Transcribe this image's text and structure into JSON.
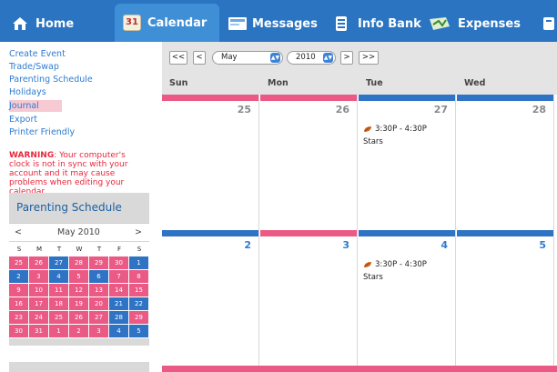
{
  "nav": {
    "tabs": [
      {
        "label": "Home",
        "icon": "home-icon"
      },
      {
        "label": "Calendar",
        "icon": "calendar-icon",
        "icon_text": "31",
        "active": true
      },
      {
        "label": "Messages",
        "icon": "messages-icon"
      },
      {
        "label": "Info Bank",
        "icon": "info-bank-icon"
      },
      {
        "label": "Expenses",
        "icon": "expenses-icon"
      }
    ]
  },
  "sidebar": {
    "links": [
      "Create Event",
      "Trade/Swap",
      "Parenting Schedule",
      "Holidays",
      "Journal",
      "Export",
      "Printer Friendly"
    ],
    "highlighted_link": "Journal",
    "warning_label": "WARNING",
    "warning_text": ": Your computer's clock is not in sync with your account and it may cause problems when editing your calendar.",
    "parenting_title": "Parenting Schedule",
    "mini_calendar": {
      "prev": "<",
      "month": "May 2010",
      "next": ">",
      "dow": [
        "S",
        "M",
        "T",
        "W",
        "T",
        "F",
        "S"
      ],
      "rows": [
        [
          "25",
          "26",
          "27",
          "28",
          "29",
          "30",
          "1"
        ],
        [
          "2",
          "3",
          "4",
          "5",
          "6",
          "7",
          "8"
        ],
        [
          "9",
          "10",
          "11",
          "12",
          "13",
          "14",
          "15"
        ],
        [
          "16",
          "17",
          "18",
          "19",
          "20",
          "21",
          "22"
        ],
        [
          "23",
          "24",
          "25",
          "26",
          "27",
          "28",
          "29"
        ],
        [
          "30",
          "31",
          "1",
          "2",
          "3",
          "4",
          "5"
        ]
      ],
      "colors": [
        [
          "p",
          "p",
          "b",
          "p",
          "p",
          "p",
          "b"
        ],
        [
          "b",
          "p",
          "b",
          "p",
          "b",
          "p",
          "p"
        ],
        [
          "p",
          "p",
          "p",
          "p",
          "p",
          "p",
          "p"
        ],
        [
          "p",
          "p",
          "p",
          "p",
          "p",
          "b",
          "b"
        ],
        [
          "p",
          "p",
          "p",
          "p",
          "p",
          "b",
          "p"
        ],
        [
          "p",
          "p",
          "p",
          "p",
          "p",
          "b",
          "b"
        ]
      ]
    }
  },
  "main": {
    "controls": {
      "first": "<<",
      "prev": "<",
      "month": "May",
      "year": "2010",
      "next": ">",
      "last": ">>"
    },
    "days_of_week": [
      "Sun",
      "Mon",
      "Tue",
      "Wed"
    ],
    "week1": [
      {
        "num": "25",
        "bar": "p",
        "style": "g"
      },
      {
        "num": "26",
        "bar": "p",
        "style": "g"
      },
      {
        "num": "27",
        "bar": "b",
        "style": "g",
        "event_time": "3:30P - 4:30P",
        "event_name": "Stars"
      },
      {
        "num": "28",
        "bar": "b",
        "style": "g"
      }
    ],
    "week2": [
      {
        "num": "2",
        "bar": "b",
        "style": "bl"
      },
      {
        "num": "3",
        "bar": "p",
        "style": "bl"
      },
      {
        "num": "4",
        "bar": "b",
        "style": "bl",
        "event_time": "3:30P - 4:30P",
        "event_name": "Stars"
      },
      {
        "num": "5",
        "bar": "b",
        "style": "bl"
      }
    ]
  },
  "colors": {
    "nav_blue": "#2a74c2",
    "nav_active": "#3f8fd6",
    "pink": "#ea5a85",
    "blue": "#2f73c4",
    "link_blue": "#2e7cd1",
    "warning_red": "#e8263b"
  }
}
